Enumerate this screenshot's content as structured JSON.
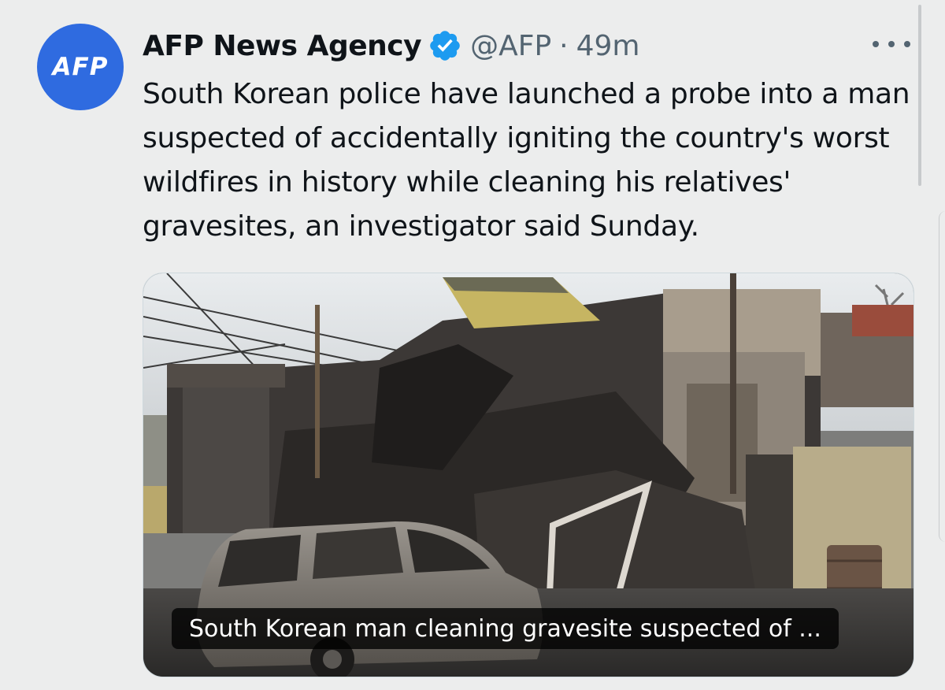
{
  "tweet": {
    "avatar_text": "AFP",
    "display_name": "AFP News Agency",
    "handle": "@AFP",
    "separator": "·",
    "time": "49m",
    "text": "South Korean police have launched a probe into a man suspected of accidentally igniting the country's worst wildfires in history while cleaning his relatives' gravesites, an investigator said Sunday.",
    "card": {
      "caption": "South Korean man cleaning gravesite suspected of ..."
    }
  },
  "icons": {
    "verified": "verified-badge-icon",
    "more": "more-options-icon"
  },
  "colors": {
    "avatar_bg": "#2f6be0",
    "verified_blue": "#1d9bf0",
    "secondary_text": "#536471"
  }
}
